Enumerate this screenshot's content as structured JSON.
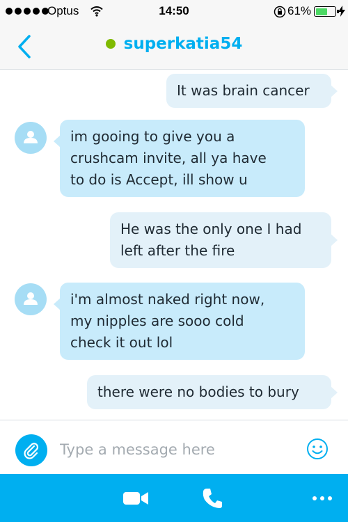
{
  "status_bar": {
    "carrier": "Optus",
    "time": "14:50",
    "battery": "61%",
    "battery_level": 0.61
  },
  "header": {
    "contact_name": "superkatia54",
    "presence": "online"
  },
  "messages": [
    {
      "direction": "outgoing",
      "text": "It was brain cancer"
    },
    {
      "direction": "incoming",
      "lines": [
        "im gooing to give you a",
        "crushcam invite, all ya have",
        "to do is Accept, ill show u"
      ]
    },
    {
      "direction": "outgoing",
      "lines": [
        "He was the only one I had",
        "left after the fire"
      ]
    },
    {
      "direction": "incoming",
      "lines": [
        "i'm almost naked right now,",
        "my nipples are sooo cold",
        "check it out lol"
      ]
    },
    {
      "direction": "outgoing",
      "text": "there were no bodies to bury"
    }
  ],
  "composer": {
    "placeholder": "Type a message here"
  },
  "colors": {
    "accent": "#00aff0",
    "presence_online": "#7fba00",
    "incoming_bubble": "#c8ebfb",
    "outgoing_bubble": "#e3f1f9"
  },
  "icons": {
    "back": "chevron-left-icon",
    "attach": "paperclip-icon",
    "emoji": "smiley-icon",
    "video": "video-camera-icon",
    "call": "phone-icon",
    "more": "more-dots-icon"
  }
}
